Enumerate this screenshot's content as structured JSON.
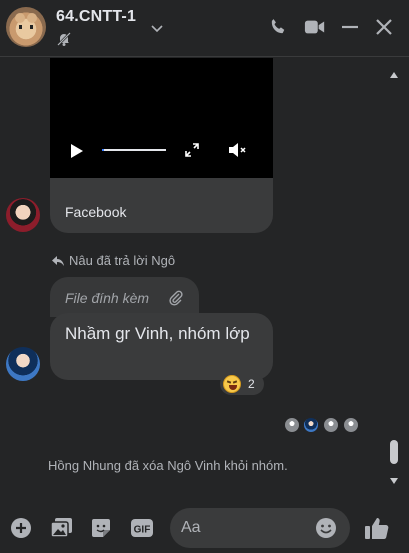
{
  "header": {
    "title": "64.CNTT-1",
    "icons": [
      "chevron-down-icon",
      "muted-bell-icon",
      "phone-icon",
      "video-call-icon",
      "minimize-icon",
      "close-icon"
    ]
  },
  "colors": {
    "background": "#242526",
    "bubble": "#3a3b3c",
    "text": "#e4e6eb",
    "secondary_text": "#b0b3b8",
    "accent": "#3a7dff"
  },
  "video_message": {
    "caption": "Facebook",
    "progress": 0.03,
    "icons": [
      "play-icon",
      "fullscreen-icon",
      "volume-muted-icon"
    ]
  },
  "reply": {
    "header": "Nâu đã trả lời Ngô",
    "quoted_text": "File đính kèm",
    "message": "Nhầm gr Vinh, nhóm lớp",
    "reaction_count": "2"
  },
  "system_message": "Hồng Nhung đã xóa Ngô Vinh khỏi nhóm.",
  "composer": {
    "placeholder": "Aa",
    "icons": [
      "plus-circle-icon",
      "gallery-icon",
      "sticker-icon",
      "gif-icon",
      "emoji-icon",
      "like-icon"
    ]
  }
}
